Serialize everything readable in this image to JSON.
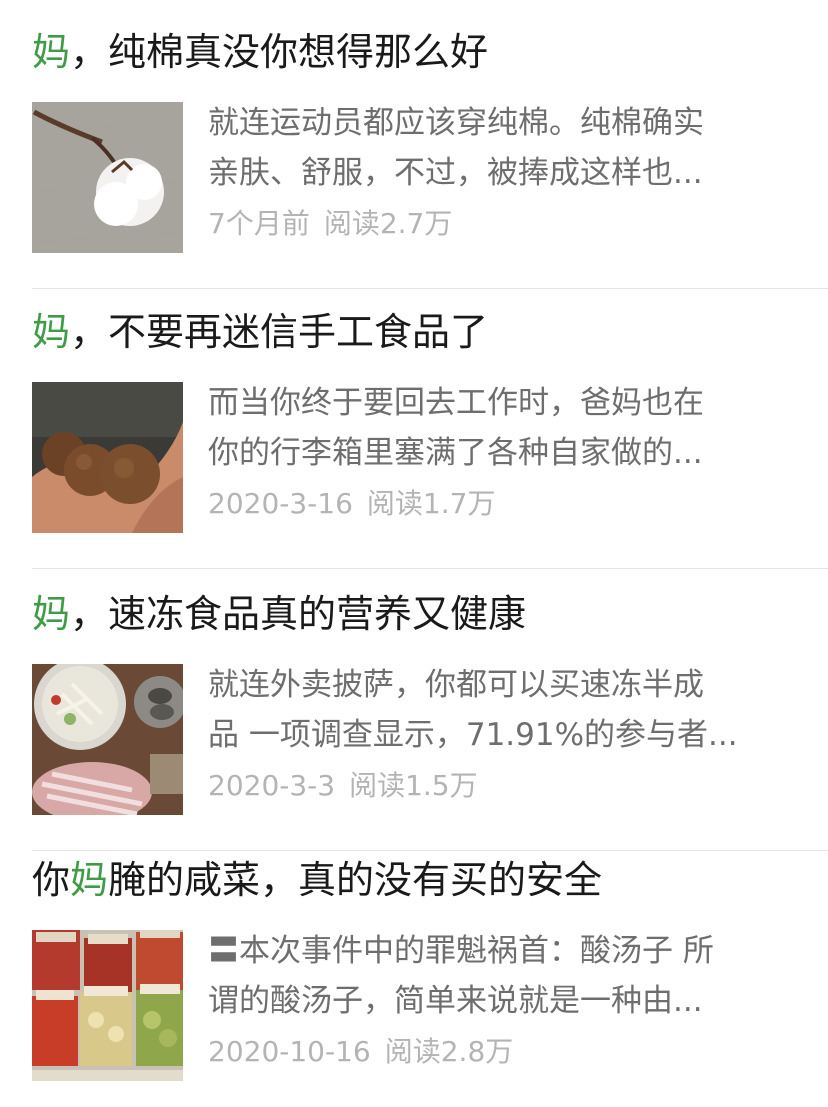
{
  "articles": [
    {
      "title_pre": "",
      "title_hl": "妈",
      "title_post": "，纯棉真没你想得那么好",
      "excerpt_line1": "就连运动员都应该穿纯棉。纯棉确实",
      "excerpt_line2": "亲肤、舒服，不过，被捧成这样也...",
      "date": "7个月前",
      "reads": "阅读2.7万",
      "thumb_icon": "cotton-boll-image"
    },
    {
      "title_pre": "",
      "title_hl": "妈",
      "title_post": "，不要再迷信手工食品了",
      "excerpt_line1": "而当你终于要回去工作时，爸妈也在",
      "excerpt_line2": "你的行李箱里塞满了各种自家做的...",
      "date": "2020-3-16",
      "reads": "阅读1.7万",
      "thumb_icon": "hands-holding-taro-image"
    },
    {
      "title_pre": "",
      "title_hl": "妈",
      "title_post": "，速冻食品真的营养又健康",
      "excerpt_line1": "就连外卖披萨，你都可以买速冻半成",
      "excerpt_line2": "品 一项调查显示，71.91%的参与者...",
      "date": "2020-3-3",
      "reads": "阅读1.5万",
      "thumb_icon": "hotpot-food-image"
    },
    {
      "title_pre": "你",
      "title_hl": "妈",
      "title_post": "腌的咸菜，真的没有买的安全",
      "excerpt_line1": "〓本次事件中的罪魁祸首：酸汤子 所",
      "excerpt_line2": "谓的酸汤子，简单来说就是一种由...",
      "date": "2020-10-16",
      "reads": "阅读2.8万",
      "thumb_icon": "pickle-jars-image"
    }
  ],
  "colors": {
    "highlight": "#3e9b46",
    "title": "#1a1a1a",
    "excerpt": "#6e6e6e",
    "meta": "#b4b4b4",
    "divider": "#e3e3e3"
  }
}
